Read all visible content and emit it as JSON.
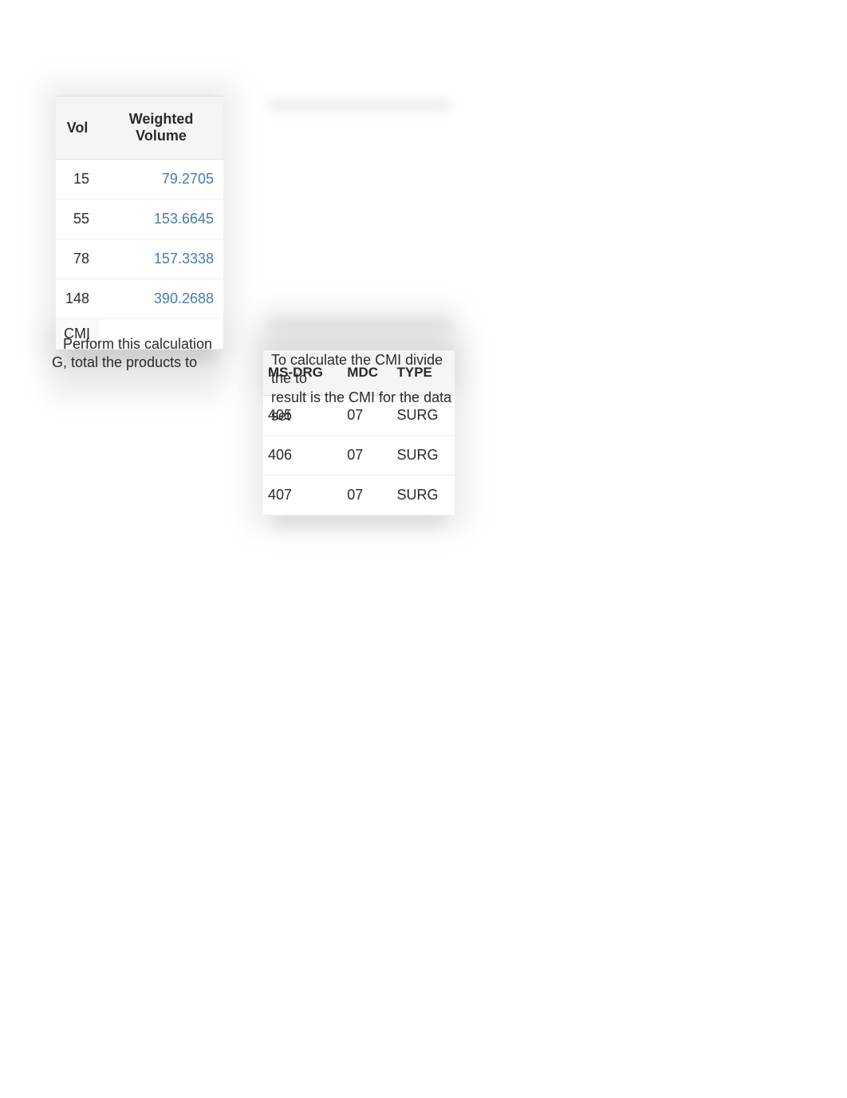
{
  "left_table": {
    "headers": {
      "vol": "Vol",
      "weighted": "Weighted Volume"
    },
    "rows": [
      {
        "vol": "15",
        "weighted": "79.2705"
      },
      {
        "vol": "55",
        "weighted": "153.6645"
      },
      {
        "vol": "78",
        "weighted": "157.3338"
      }
    ],
    "total": {
      "vol": "148",
      "weighted": "390.2688"
    },
    "cmi_label": "CMI"
  },
  "right_table": {
    "headers": {
      "msdrg": "MS-DRG",
      "mdc": "MDC",
      "type": "TYPE"
    },
    "rows": [
      {
        "msdrg": "405",
        "mdc": "07",
        "type": "SURG"
      },
      {
        "msdrg": "406",
        "mdc": "07",
        "type": "SURG"
      },
      {
        "msdrg": "407",
        "mdc": "07",
        "type": "SURG"
      }
    ]
  },
  "text_left": {
    "line1": "Perform this calculation",
    "line2": "G, total the products to"
  },
  "text_right": {
    "line1": "To calculate the CMI divide the to",
    "line2": "result is the CMI for the data set"
  }
}
